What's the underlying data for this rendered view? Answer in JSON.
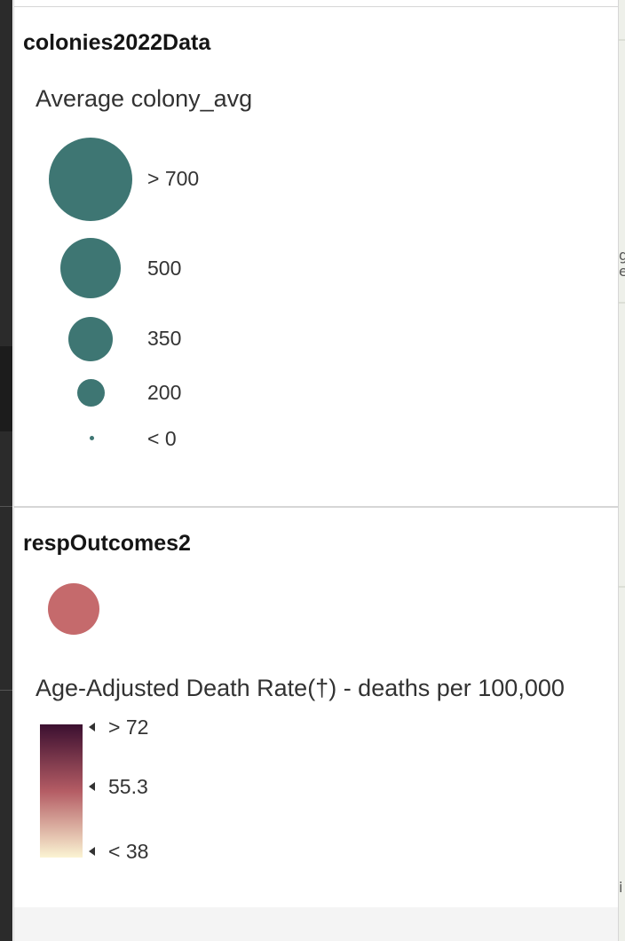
{
  "legend": {
    "colonies": {
      "layer_title": "colonies2022Data",
      "field_title": "Average colony_avg",
      "symbol_color": "#3e7673",
      "size_stops": [
        {
          "label": "> 700"
        },
        {
          "label": "500"
        },
        {
          "label": "350"
        },
        {
          "label": "200"
        },
        {
          "label": "< 0"
        }
      ]
    },
    "resp": {
      "layer_title": "respOutcomes2",
      "symbol_color": "#c56a6c",
      "field_title": "Age-Adjusted Death Rate(†) - deaths per 100,000",
      "ramp_colors": [
        "#3b0f30",
        "#b45c64",
        "#fbf4d3"
      ],
      "ramp_stops": [
        {
          "label": "> 72"
        },
        {
          "label": "55.3"
        },
        {
          "label": "< 38"
        }
      ]
    }
  },
  "map_edge": {
    "glyph_a": "g",
    "glyph_b": "e",
    "glyph_c": "i"
  }
}
